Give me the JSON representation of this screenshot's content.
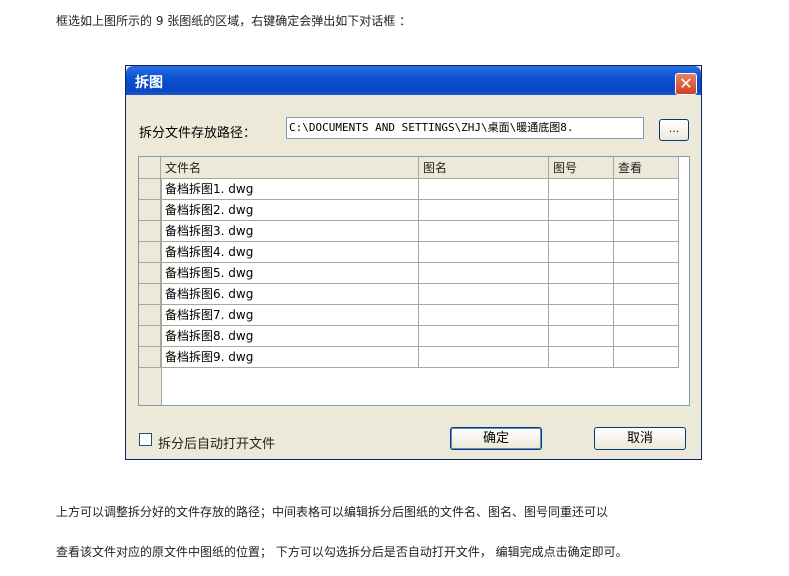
{
  "intro_text": "框选如上图所示的   9 张图纸的区域，右键确定会弹出如下对话框       ：",
  "dialog": {
    "title": "拆图",
    "close_glyph": "✕",
    "path_label": "拆分文件存放路径：",
    "path_value": "C:\\DOCUMENTS AND SETTINGS\\ZHJ\\桌面\\暖通底图8.",
    "browse_label": "...",
    "columns": [
      "文件名",
      "图名",
      "图号",
      "查看"
    ],
    "rows": [
      {
        "file": "备档拆图1. dwg",
        "name": "",
        "number": "",
        "view": ""
      },
      {
        "file": "备档拆图2. dwg",
        "name": "",
        "number": "",
        "view": ""
      },
      {
        "file": "备档拆图3. dwg",
        "name": "",
        "number": "",
        "view": ""
      },
      {
        "file": "备档拆图4. dwg",
        "name": "",
        "number": "",
        "view": ""
      },
      {
        "file": "备档拆图5. dwg",
        "name": "",
        "number": "",
        "view": ""
      },
      {
        "file": "备档拆图6. dwg",
        "name": "",
        "number": "",
        "view": ""
      },
      {
        "file": "备档拆图7. dwg",
        "name": "",
        "number": "",
        "view": ""
      },
      {
        "file": "备档拆图8. dwg",
        "name": "",
        "number": "",
        "view": ""
      },
      {
        "file": "备档拆图9. dwg",
        "name": "",
        "number": "",
        "view": ""
      }
    ],
    "auto_open_label": "拆分后自动打开文件",
    "auto_open_checked": false,
    "ok_label": "确定",
    "cancel_label": "取消"
  },
  "para2": "上方可以调整拆分好的文件存放的路径；中间表格可以编辑拆分后图纸的文件名、图名、图号同重还可以",
  "para3": "查看该文件对应的原文件中图纸的位置；      下方可以勾选拆分后是否自动打开文件，      编辑完成点击确定即可。",
  "colors": {
    "titlebar": "#0a4fd2",
    "close": "#d1401a",
    "dialog_bg": "#ece9d8"
  }
}
